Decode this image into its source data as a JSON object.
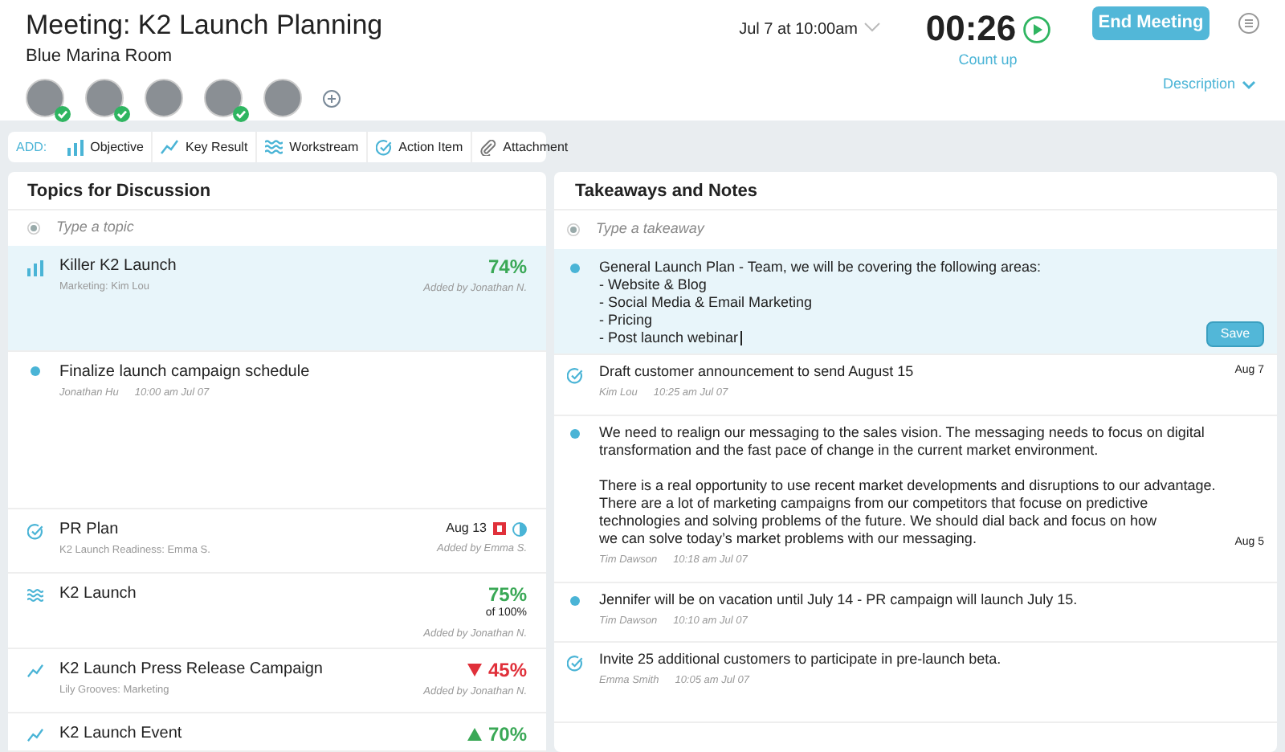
{
  "header": {
    "title": "Meeting: K2 Launch Planning",
    "room": "Blue Marina Room",
    "date": "Jul 7 at 10:00am",
    "timer": "00:26",
    "timer_mode": "Count up",
    "end_button": "End Meeting",
    "description_link": "Description",
    "attendees": [
      {
        "checked": true
      },
      {
        "checked": true
      },
      {
        "checked": false
      },
      {
        "checked": true
      },
      {
        "checked": false
      }
    ]
  },
  "toolbar": {
    "label": "ADD:",
    "items": [
      {
        "kind": "objective",
        "label": "Objective"
      },
      {
        "kind": "keyresult",
        "label": "Key Result"
      },
      {
        "kind": "workstream",
        "label": "Workstream"
      },
      {
        "kind": "action",
        "label": "Action Item"
      },
      {
        "kind": "attachment",
        "label": "Attachment"
      }
    ]
  },
  "topics": {
    "title": "Topics for Discussion",
    "placeholder": "Type a topic",
    "items": [
      {
        "kind": "objective",
        "selected": true,
        "title": "Killer K2 Launch",
        "subtitle": "Marketing: Kim Lou",
        "percent": "74%",
        "rising": false,
        "declining": false,
        "added_by": "Added by Jonathan N."
      },
      {
        "kind": "note",
        "selected": false,
        "title": "Finalize launch campaign schedule",
        "author": "Jonathan Hu",
        "time": "10:00 am Jul 07"
      },
      {
        "kind": "action",
        "selected": false,
        "title": "PR Plan",
        "subtitle": "K2 Launch Readiness: Emma S.",
        "date": "Aug 13",
        "added_by": "Added by Emma S."
      },
      {
        "kind": "workstream",
        "selected": false,
        "title": "K2 Launch",
        "percent": "75%",
        "rising": false,
        "declining": false,
        "of": "of 100%",
        "added_by": "Added by Jonathan N."
      },
      {
        "kind": "keyresult",
        "selected": false,
        "title": "K2 Launch Press Release Campaign",
        "subtitle": "Lily Grooves: Marketing",
        "percent": "45%",
        "rising": false,
        "declining": true,
        "added_by": "Added by Jonathan N."
      },
      {
        "kind": "keyresult",
        "selected": false,
        "title": "K2 Launch Event",
        "percent": "70%",
        "rising": true,
        "declining": false
      }
    ]
  },
  "notes": {
    "title": "Takeaways and Notes",
    "placeholder": "Type a takeaway",
    "save_button": "Save",
    "items": [
      {
        "kind": "editing",
        "selected": true,
        "text": "General Launch Plan - Team, we will be covering the following areas:\n- Website & Blog\n- Social Media & Email Marketing\n- Pricing\n- Post launch webinar"
      },
      {
        "kind": "action",
        "selected": false,
        "text": "Draft customer announcement to send August 15",
        "author": "Kim Lou",
        "time": "10:25 am Jul 07",
        "date": "Aug 7"
      },
      {
        "kind": "note",
        "selected": false,
        "text": "We need to realign our messaging to the sales vision. The messaging needs to focus on digital\ntransformation and the fast pace of change in the current market environment.\n\nThere is a real opportunity to use recent market developments and disruptions to our advantage.\nThere are a lot of marketing campaigns from our competitors that focuse on predictive\ntechnologies and solving problems of the future. We should dial back and focus on how\nwe can solve today’s market problems with our messaging.",
        "author": "Tim Dawson",
        "time": "10:18 am Jul 07",
        "date": "Aug 5"
      },
      {
        "kind": "note",
        "selected": false,
        "text": "Jennifer will be on vacation until July 14 - PR campaign will launch July 15.",
        "author": "Tim Dawson",
        "time": "10:10 am Jul 07"
      },
      {
        "kind": "action",
        "selected": false,
        "text": "Invite 25 additional customers to participate in pre-launch beta.",
        "author": "Emma Smith",
        "time": "10:05 am Jul 07"
      }
    ]
  }
}
